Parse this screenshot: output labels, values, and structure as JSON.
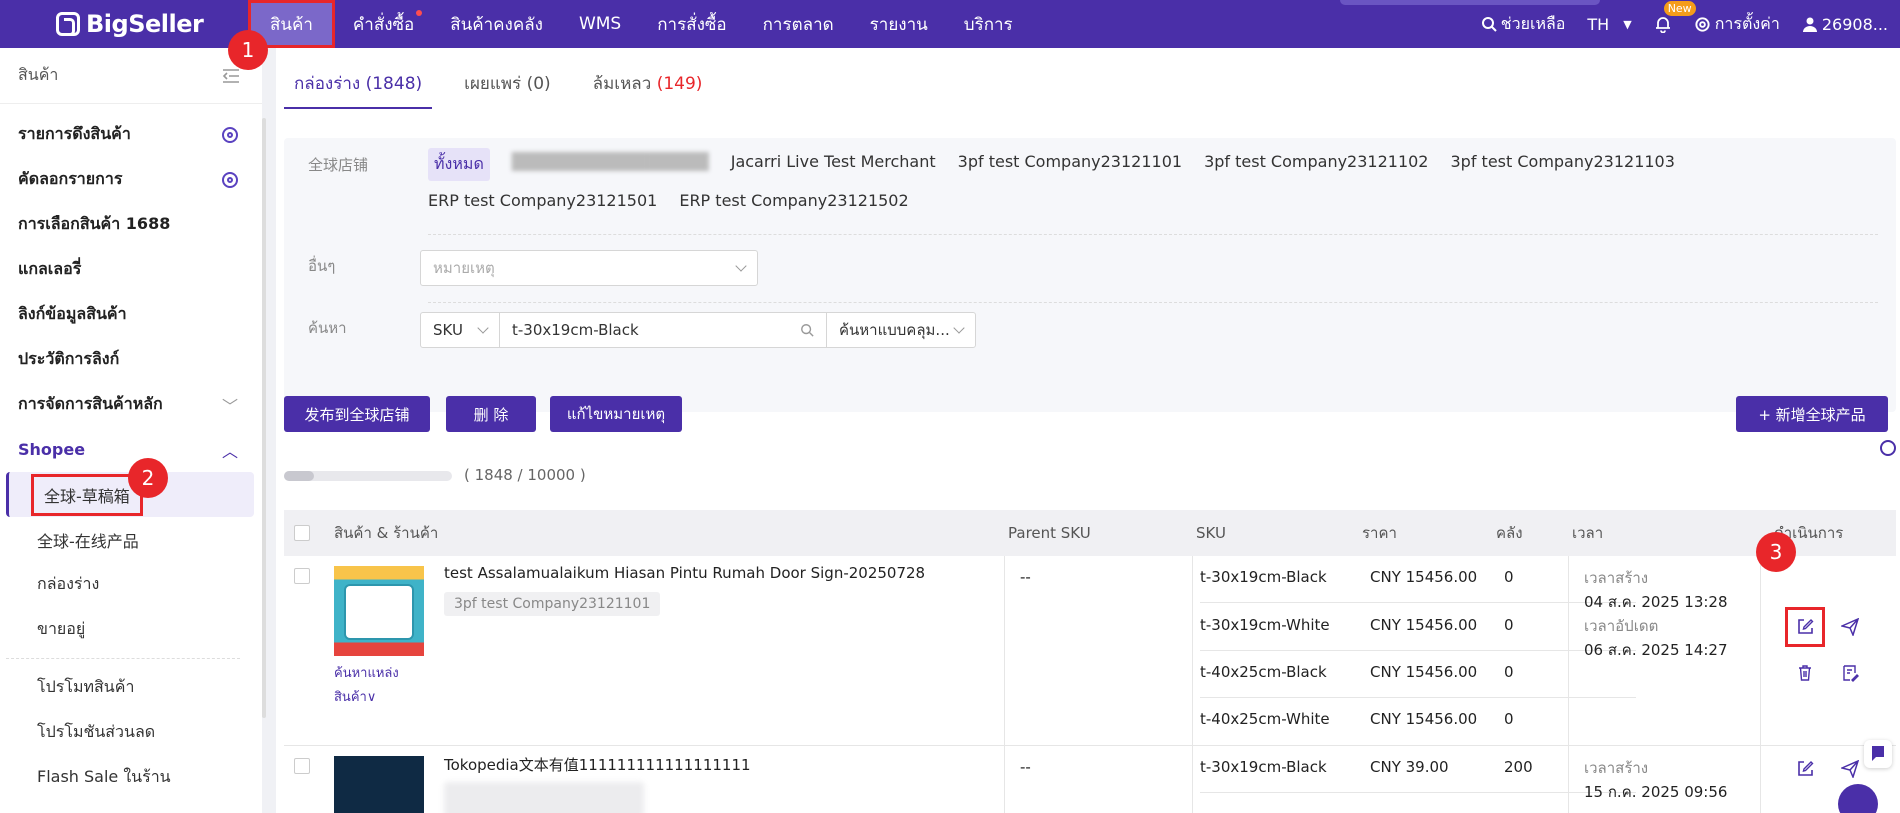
{
  "app": {
    "logo": "BigSeller"
  },
  "topnav": {
    "items": [
      {
        "label": "สินค้า"
      },
      {
        "label": "คำสั่งซื้อ"
      },
      {
        "label": "สินค้าคงคลัง"
      },
      {
        "label": "WMS"
      },
      {
        "label": "การสั่งซื้อ"
      },
      {
        "label": "การตลาด"
      },
      {
        "label": "รายงาน"
      },
      {
        "label": "บริการ"
      }
    ],
    "help": "ช่วยเหลือ",
    "language": "TH",
    "new_badge": "New",
    "settings": "การตั้งค่า",
    "user": "26908..."
  },
  "sidebar": {
    "title": "สินค้า",
    "items": [
      {
        "label": "รายการดึงสินค้า"
      },
      {
        "label": "คัดลอกรายการ"
      },
      {
        "label": "การเลือกสินค้า 1688"
      },
      {
        "label": "แกลเลอรี่"
      },
      {
        "label": "ลิงก์ข้อมูลสินค้า"
      },
      {
        "label": "ประวัติการลิงก์"
      },
      {
        "label": "การจัดการสินค้าหลัก"
      }
    ],
    "section": "Shopee",
    "sub_items": [
      {
        "label": "全球-草稿箱"
      },
      {
        "label": "全球-在线产品"
      },
      {
        "label": "กล่องร่าง"
      },
      {
        "label": "ขายอยู่"
      }
    ],
    "sub_items2": [
      {
        "label": "โปรโมทสินค้า"
      },
      {
        "label": "โปรโมชันส่วนลด"
      },
      {
        "label": "Flash Sale ในร้าน"
      }
    ]
  },
  "tabs": [
    {
      "label": "กล่องร่าง",
      "count": "(1848)"
    },
    {
      "label": "เผยแพร่",
      "count": "(0)"
    },
    {
      "label": "ล้มเหลว",
      "count": "(149)"
    }
  ],
  "filter": {
    "store_label": "全球店铺",
    "stores": [
      "ทั้งหมด",
      "Jacarri Live Test Merchant",
      "3pf test Company23121101",
      "3pf test Company23121102",
      "3pf test Company23121103",
      "ERP test Company23121501",
      "ERP test Company23121502"
    ],
    "other_label": "อื่นๆ",
    "remark_placeholder": "หมายเหตุ",
    "search_label": "ค้นหา",
    "search_field": "SKU",
    "search_value": "t-30x19cm-Black",
    "search_mode": "ค้นหาแบบคลุม..."
  },
  "actions": {
    "publish": "发布到全球店铺",
    "delete": "删 除",
    "edit_remark": "แก้ไขหมายเหตุ",
    "add_global": "+ 新增全球产品"
  },
  "progress": {
    "text": "( 1848 / 10000 )",
    "value": 0.18
  },
  "table": {
    "headers": {
      "product": "สินค้า & ร้านค้า",
      "parent_sku": "Parent SKU",
      "sku": "SKU",
      "price": "ราคา",
      "stock": "คลัง",
      "time": "เวลา",
      "action": "ดำเนินการ"
    },
    "rows": [
      {
        "name": "test Assalamualaikum Hiasan Pintu Rumah Door Sign-20250728",
        "store": "3pf test Company23121101",
        "source_link": "ค้นหาแหล่ง",
        "source_link2": "สินค้า∨",
        "parent_sku": "--",
        "variants": [
          {
            "sku": "t-30x19cm-Black",
            "price": "CNY 15456.00",
            "stock": "0"
          },
          {
            "sku": "t-30x19cm-White",
            "price": "CNY 15456.00",
            "stock": "0"
          },
          {
            "sku": "t-40x25cm-Black",
            "price": "CNY 15456.00",
            "stock": "0"
          },
          {
            "sku": "t-40x25cm-White",
            "price": "CNY 15456.00",
            "stock": "0"
          }
        ],
        "created_label": "เวลาสร้าง",
        "created": "04 ส.ค. 2025 13:28",
        "updated_label": "เวลาอัปเดต",
        "updated": "06 ส.ค. 2025 14:27"
      },
      {
        "name": "Tokopedia文本有值111111111111111111",
        "parent_sku": "--",
        "variants": [
          {
            "sku": "t-30x19cm-Black",
            "price": "CNY 39.00",
            "stock": "200"
          }
        ],
        "created_label": "เวลาสร้าง",
        "created": "15 ก.ค. 2025 09:56"
      }
    ]
  },
  "annotations": [
    "1",
    "2",
    "3"
  ],
  "colors": {
    "brand": "#4a2fa8",
    "highlight": "#e8262a",
    "danger": "#e8262a"
  }
}
